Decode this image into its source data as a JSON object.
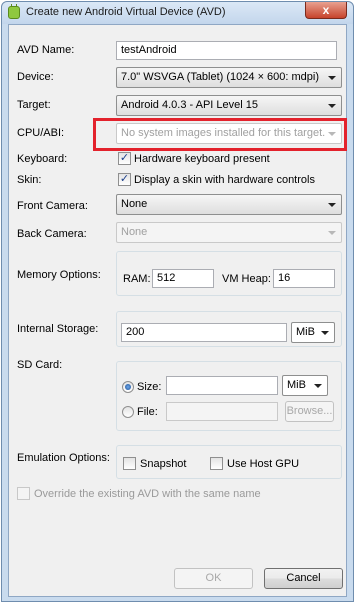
{
  "window": {
    "title": "Create new Android Virtual Device (AVD)",
    "close_glyph": "x"
  },
  "avd_name": {
    "label": "AVD Name:",
    "value": "testAndroid"
  },
  "device": {
    "label": "Device:",
    "value": "7.0\" WSVGA (Tablet) (1024 × 600: mdpi)"
  },
  "target": {
    "label": "Target:",
    "value": "Android 4.0.3 - API Level 15"
  },
  "cpu_abi": {
    "label": "CPU/ABI:",
    "value": "No system images installed for this target."
  },
  "keyboard": {
    "label": "Keyboard:",
    "checkbox_label": "Hardware keyboard present",
    "checked": true
  },
  "skin": {
    "label": "Skin:",
    "checkbox_label": "Display a skin with hardware controls",
    "checked": true
  },
  "front_camera": {
    "label": "Front Camera:",
    "value": "None"
  },
  "back_camera": {
    "label": "Back Camera:",
    "value": "None"
  },
  "memory": {
    "label": "Memory Options:",
    "ram_label": "RAM:",
    "ram_value": "512",
    "heap_label": "VM Heap:",
    "heap_value": "16"
  },
  "internal_storage": {
    "label": "Internal Storage:",
    "value": "200",
    "unit": "MiB"
  },
  "sd_card": {
    "label": "SD Card:",
    "size_label": "Size:",
    "size_value": "",
    "size_unit": "MiB",
    "file_label": "File:",
    "file_value": "",
    "browse_label": "Browse..."
  },
  "emulation": {
    "label": "Emulation Options:",
    "snapshot_label": "Snapshot",
    "host_gpu_label": "Use Host GPU"
  },
  "override": {
    "label": "Override the existing AVD with the same name"
  },
  "buttons": {
    "ok": "OK",
    "cancel": "Cancel"
  },
  "colors": {
    "highlight_border": "#e3222c",
    "window_frame": "#c9dbee",
    "dialog_bg": "#f0f0f0"
  },
  "icons": {
    "app": "android-icon",
    "check": "✓"
  }
}
